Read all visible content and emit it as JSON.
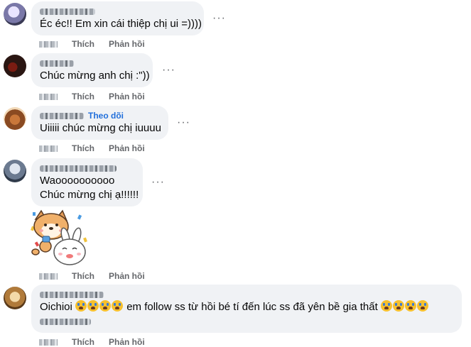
{
  "actions": {
    "like": "Thích",
    "reply": "Phản hồi"
  },
  "more_label": "···",
  "comments": [
    {
      "text": "Éc éc!! Em xin cái thiệp chị ui =))))"
    },
    {
      "text": "Chúc mừng anh chị :\"))"
    },
    {
      "follow": "Theo dõi",
      "text": "Uiiiii chúc mừng chị iuuuu"
    },
    {
      "line1": "Waoooooooooo",
      "line2": "Chúc mừng chị ạ!!!!!!"
    },
    {
      "text_before": "Oichioi",
      "text_after": "em follow ss từ hồi bé tí đến lúc ss đã yên bề gia thất"
    }
  ],
  "colors": {
    "bubble": "#f0f2f5",
    "muted": "#65676b",
    "link": "#216fdb"
  }
}
